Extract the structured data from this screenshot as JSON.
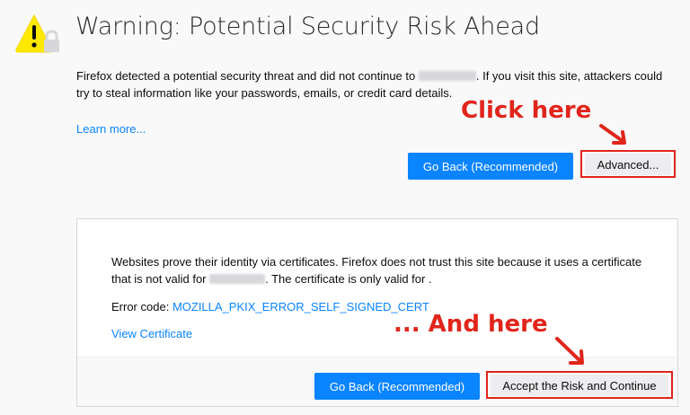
{
  "header": {
    "title": "Warning: Potential Security Risk Ahead"
  },
  "intro": {
    "text_before": "Firefox detected a potential security threat and did not continue to",
    "text_after": ". If you visit this site, attackers could try to steal information like your passwords, emails, or credit card details.",
    "learn_more": "Learn more..."
  },
  "buttons": {
    "go_back": "Go Back (Recommended)",
    "advanced": "Advanced...",
    "accept": "Accept the Risk and Continue"
  },
  "advanced_panel": {
    "text1_before": "Websites prove their identity via certificates. Firefox does not trust this site because it uses a certificate that is not valid for",
    "text1_after": ". The certificate is only valid for .",
    "error_label": "Error code:",
    "error_code": "MOZILLA_PKIX_ERROR_SELF_SIGNED_CERT",
    "view_certificate": "View Certificate"
  },
  "annotations": {
    "first": "Click here",
    "second": "... And here"
  },
  "icons": {
    "warning": "warning-triangle-lock-icon"
  },
  "colors": {
    "accent": "#0a84ff",
    "annotation": "#e1251b",
    "warning": "#ffe900"
  }
}
